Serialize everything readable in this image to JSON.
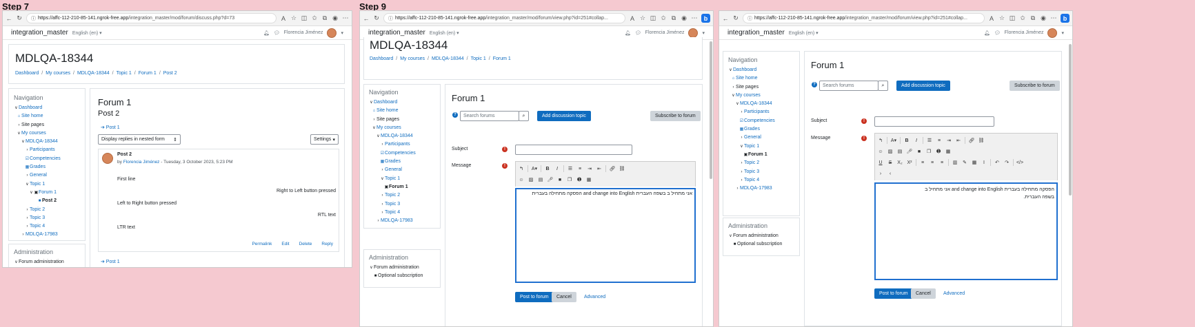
{
  "steps": [
    "Step 7",
    "Step 9"
  ],
  "browser": {
    "url1_host": "https://affc-112-210-85-141.ngrok-free.app",
    "url1_path": "/integration_master/mod/forum/discuss.php?d=73",
    "url2_host": "https://affc-112-210-85-141.ngrok-free.app",
    "url2_path": "/integration_master/mod/forum/view.php?id=251#collap...",
    "url3_host": "https://affc-112-210-85-141.ngrok-free.app",
    "url3_path": "/integration_master/mod/forum/view.php?id=251#collap...",
    "icons": [
      "back-icon",
      "reload-icon",
      "info-icon",
      "read-aloud-icon",
      "favorite-icon",
      "split-icon",
      "favorites-icon",
      "collections-icon",
      "profile-icon",
      "more-icon",
      "bing-icon"
    ]
  },
  "navbar": {
    "site_name": "integration_master",
    "language": "English (en) ▾",
    "user_name": "Florencia Jiménez",
    "bell_icon": "bell-icon",
    "chat_icon": "chat-icon"
  },
  "course": {
    "title": "MDLQA-18344",
    "crumbs1": [
      "Dashboard",
      "My courses",
      "MDLQA-18344",
      "Topic 1",
      "Forum 1",
      "Post 2"
    ],
    "crumbs2": [
      "Dashboard",
      "My courses",
      "MDLQA-18344",
      "Topic 1",
      "Forum 1"
    ]
  },
  "navigation": {
    "title": "Navigation",
    "items": [
      "Dashboard",
      "Site home",
      "Site pages",
      "My courses",
      "MDLQA-18344",
      "Participants",
      "Competencies",
      "Grades",
      "General",
      "Topic 1",
      "Forum 1",
      "Post 2",
      "Topic 2",
      "Topic 3",
      "Topic 4",
      "MDLQA-17983"
    ]
  },
  "administration": {
    "title": "Administration",
    "forum_admin": "Forum administration",
    "optional_sub": "Optional subscription"
  },
  "discussion": {
    "forum_title": "Forum 1",
    "post_title": "Post 2",
    "prev_link": "➔ Post 1",
    "display_mode": "Display replies in nested form",
    "settings": "Settings",
    "post_subject": "Post 2",
    "post_by": "by",
    "author": "Florencia Jiménez",
    "post_date": " - Tuesday, 3 October 2023, 5:23 PM",
    "lines": [
      "First line",
      "Right to Left button pressed",
      "Left to Right button pressed",
      "RTL text",
      "LTR text"
    ],
    "actions": [
      "Permalink",
      "Edit",
      "Delete",
      "Reply"
    ],
    "next_link": "➔ Post 1"
  },
  "forum_form": {
    "title": "Forum 1",
    "search_placeholder": "Search forums",
    "add_topic": "Add discussion topic",
    "subscribe": "Subscribe to forum",
    "subject_label": "Subject",
    "message_label": "Message",
    "editor_text_step9": "אני מתחיל ב בשפה העברית and change into English הפסקה מתחילה בעברית",
    "editor_text_final_line1": "הפסקה מתחילה בעברית and change into English אני מתחיל ב",
    "editor_text_final_line2": "בשפה העברית.",
    "post_button": "Post to forum",
    "cancel_button": "Cancel",
    "advanced_link": "Advanced"
  },
  "colors": {
    "background": "#f5c9d0",
    "link": "#0f6cbf",
    "primary": "#0f6cbf",
    "required": "#ca3120",
    "editor_border": "#1f6fcf"
  }
}
